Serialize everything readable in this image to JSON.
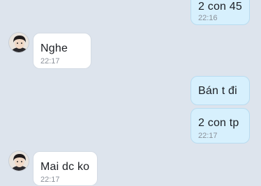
{
  "conversation": {
    "messages": [
      {
        "sender": "me",
        "text": "2 con 45",
        "time": "22:16"
      },
      {
        "sender": "contact",
        "text": "Nghe",
        "time": "22:17"
      },
      {
        "sender": "me",
        "text": "Bán t đi",
        "time": ""
      },
      {
        "sender": "me",
        "text": "2 con tp",
        "time": "22:17"
      },
      {
        "sender": "contact",
        "text": "Mai dc ko",
        "time": "22:17"
      }
    ]
  },
  "colors": {
    "background": "#dde4ed",
    "my_bubble": "#d7f0fd",
    "their_bubble": "#ffffff",
    "timestamp": "#8a9099"
  },
  "icons": {
    "contact_avatar": "contact-avatar-icon"
  }
}
